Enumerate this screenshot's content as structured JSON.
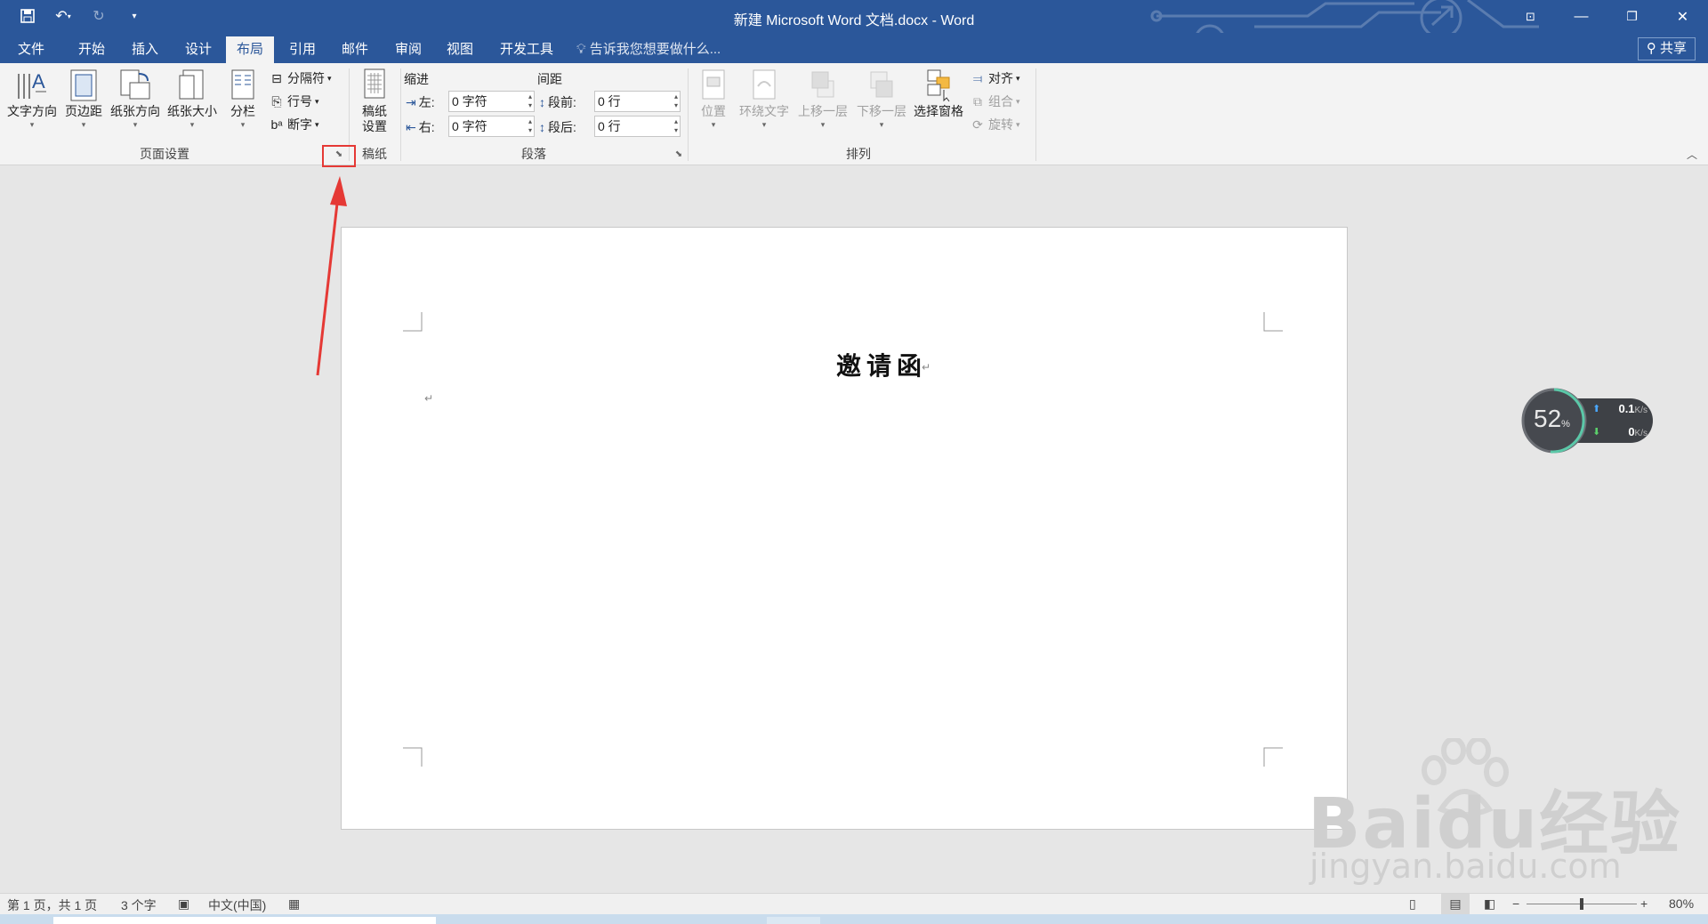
{
  "window": {
    "title": "新建 Microsoft Word 文档.docx - Word",
    "controls": [
      "restore-ribbon",
      "minimize",
      "maximize",
      "close"
    ]
  },
  "tabs": [
    {
      "label": "文件",
      "active": false
    },
    {
      "label": "开始",
      "active": false
    },
    {
      "label": "插入",
      "active": false
    },
    {
      "label": "设计",
      "active": false
    },
    {
      "label": "布局",
      "active": true
    },
    {
      "label": "引用",
      "active": false
    },
    {
      "label": "邮件",
      "active": false
    },
    {
      "label": "审阅",
      "active": false
    },
    {
      "label": "视图",
      "active": false
    },
    {
      "label": "开发工具",
      "active": false
    }
  ],
  "tell_me": "告诉我您想要做什么...",
  "share": "共享",
  "ribbon": {
    "page_setup": {
      "label": "页面设置",
      "text_direction": "文字方向",
      "margins": "页边距",
      "orientation": "纸张方向",
      "size": "纸张大小",
      "columns": "分栏",
      "breaks": "分隔符",
      "line_numbers": "行号",
      "hyphenation": "断字"
    },
    "draft_paper": {
      "label": "稿纸",
      "button_line1": "稿纸",
      "button_line2": "设置"
    },
    "paragraph": {
      "label": "段落",
      "indent_title": "缩进",
      "spacing_title": "间距",
      "left_label": "左:",
      "left_value": "0 字符",
      "right_label": "右:",
      "right_value": "0 字符",
      "before_label": "段前:",
      "before_value": "0 行",
      "after_label": "段后:",
      "after_value": "0 行"
    },
    "arrange": {
      "label": "排列",
      "position": "位置",
      "wrap_text": "环绕文字",
      "bring_forward": "上移一层",
      "send_backward": "下移一层",
      "selection_pane": "选择窗格",
      "align": "对齐",
      "group": "组合",
      "rotate": "旋转"
    }
  },
  "document": {
    "heading": "邀请函"
  },
  "net_widget": {
    "percent": "52",
    "percent_sign": "%",
    "upload": "0.1",
    "download": "0",
    "unit": "K/s"
  },
  "watermark": {
    "line1": "Baidu经验",
    "line2": "jingyan.baidu.com"
  },
  "status": {
    "page": "第 1 页，共 1 页",
    "words": "3 个字",
    "language": "中文(中国)",
    "zoom": "80%",
    "zoom_fraction": 0.5
  },
  "colors": {
    "accent": "#2b579a",
    "highlight": "#e53935"
  }
}
